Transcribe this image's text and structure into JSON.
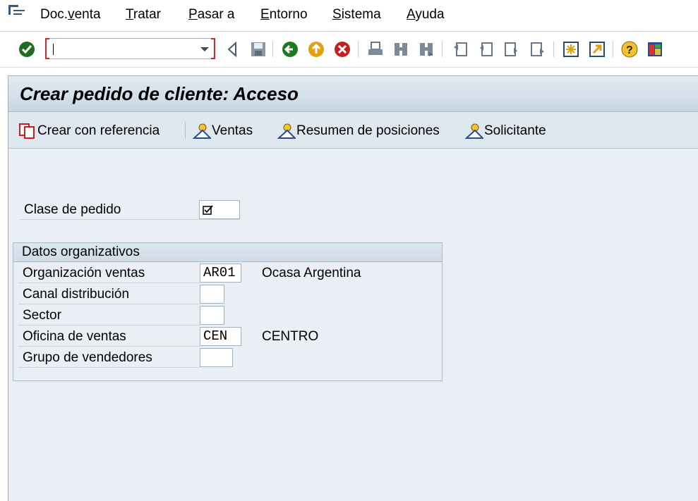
{
  "menubar": {
    "items": [
      {
        "label": "Doc.venta",
        "accel": "v"
      },
      {
        "label": "Tratar",
        "accel": "T"
      },
      {
        "label": "Pasar a",
        "accel": "P"
      },
      {
        "label": "Entorno",
        "accel": "E"
      },
      {
        "label": "Sistema",
        "accel": "S"
      },
      {
        "label": "Ayuda",
        "accel": "A"
      }
    ]
  },
  "toolbar": {
    "command_field_value": "",
    "icons": [
      "enter-icon",
      "back-triangle-icon",
      "save-icon",
      "back-icon",
      "exit-icon",
      "cancel-icon",
      "print-icon",
      "find-icon",
      "find-next-icon",
      "first-page-icon",
      "previous-page-icon",
      "next-page-icon",
      "last-page-icon",
      "create-session-icon",
      "shortcut-icon",
      "help-icon",
      "layout-menu-icon"
    ]
  },
  "title": "Crear pedido de cliente: Acceso",
  "app_toolbar": {
    "create_with_ref": "Crear con referencia",
    "sales": "Ventas",
    "item_overview": "Resumen de posiciones",
    "sold_to": "Solicitante"
  },
  "form": {
    "order_type_label": "Clase de pedido",
    "order_type_value": "",
    "org_group_title": "Datos organizativos",
    "sales_org_label": "Organización ventas",
    "sales_org_value": "AR01",
    "sales_org_desc": "Ocasa Argentina",
    "dist_channel_label": "Canal distribución",
    "dist_channel_value": "",
    "division_label": "Sector",
    "division_value": "",
    "sales_office_label": "Oficina de ventas",
    "sales_office_value": "CEN",
    "sales_office_desc": "CENTRO",
    "sales_group_label": "Grupo de vendedores",
    "sales_group_value": ""
  },
  "colors": {
    "background": "#e9eff5",
    "title_bar": "#d3dfea",
    "accent_red": "#d4262b",
    "enter_green": "#2e8b2e"
  }
}
